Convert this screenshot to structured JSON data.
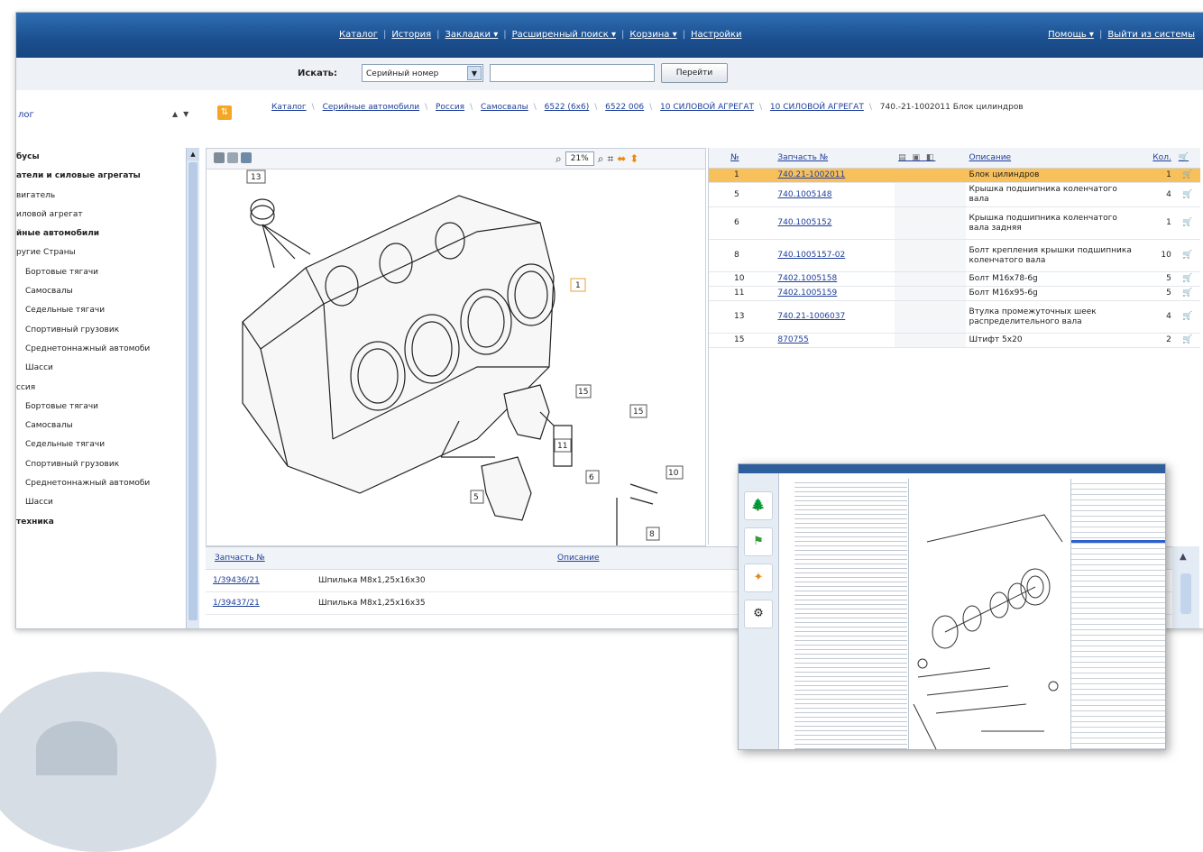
{
  "nav": {
    "items": [
      "Каталог",
      "История",
      "Закладки ▾",
      "Расширенный поиск ▾",
      "Корзина ▾",
      "Настройки"
    ],
    "right": [
      "Помощь ▾",
      "Выйти из системы"
    ]
  },
  "search": {
    "label": "Искать:",
    "type_value": "Серийный номер",
    "input_value": "",
    "go_label": "Перейти"
  },
  "left_header": {
    "catalog_label": "лог"
  },
  "breadcrumb": [
    "Каталог",
    "Серийные автомобили",
    "Россия",
    "Самосвалы",
    "6522 (6x6)",
    "6522 006",
    "10 СИЛОВОЙ АГРЕГАТ",
    "10 СИЛОВОЙ АГРЕГАТ",
    "740.-21-1002011 Блок цилиндров"
  ],
  "tree": [
    {
      "label": "бусы",
      "bold": true,
      "level": 0
    },
    {
      "label": "атели и силовые агрегаты",
      "bold": true,
      "level": 0
    },
    {
      "label": "вигатель",
      "bold": false,
      "level": 0
    },
    {
      "label": "иловой агрегат",
      "bold": false,
      "level": 0
    },
    {
      "label": "йные автомобили",
      "bold": true,
      "level": 0
    },
    {
      "label": "ругие Страны",
      "bold": false,
      "level": 0
    },
    {
      "label": "Бортовые тягачи",
      "bold": false,
      "level": 1
    },
    {
      "label": "Самосвалы",
      "bold": false,
      "level": 1
    },
    {
      "label": "Седельные тягачи",
      "bold": false,
      "level": 1
    },
    {
      "label": "Спортивный грузовик",
      "bold": false,
      "level": 1
    },
    {
      "label": "Среднетоннажный автомоби",
      "bold": false,
      "level": 1
    },
    {
      "label": "Шасси",
      "bold": false,
      "level": 1
    },
    {
      "label": "ссия",
      "bold": false,
      "level": 0
    },
    {
      "label": "Бортовые тягачи",
      "bold": false,
      "level": 1
    },
    {
      "label": "Самосвалы",
      "bold": false,
      "level": 1
    },
    {
      "label": "Седельные тягачи",
      "bold": false,
      "level": 1
    },
    {
      "label": "Спортивный грузовик",
      "bold": false,
      "level": 1
    },
    {
      "label": "Среднетоннажный автомоби",
      "bold": false,
      "level": 1
    },
    {
      "label": "Шасси",
      "bold": false,
      "level": 1
    },
    {
      "label": "техника",
      "bold": true,
      "level": 0
    }
  ],
  "image_toolbar": {
    "zoom": "21%"
  },
  "diagram_labels": [
    "13",
    "1",
    "15",
    "15",
    "11",
    "6",
    "10",
    "5",
    "8"
  ],
  "parts_table": {
    "headers": {
      "num": "№",
      "part": "Запчасть №",
      "desc": "Описание",
      "qty": "Кол."
    },
    "rows": [
      {
        "num": "1",
        "part": "740.21-1002011",
        "desc": "Блок цилиндров",
        "qty": "1",
        "selected": true
      },
      {
        "num": "5",
        "part": "740.1005148",
        "desc": "Крышка подшипника коленчатого вала",
        "qty": "4",
        "selected": false
      },
      {
        "num": "6",
        "part": "740.1005152",
        "desc": "Крышка подшипника коленчатого вала задняя",
        "qty": "1",
        "selected": false
      },
      {
        "num": "8",
        "part": "740.1005157-02",
        "desc": "Болт крепления крышки подшипника коленчатого вала",
        "qty": "10",
        "selected": false
      },
      {
        "num": "10",
        "part": "7402.1005158",
        "desc": "Болт М16х78-6g",
        "qty": "5",
        "selected": false
      },
      {
        "num": "11",
        "part": "7402.1005159",
        "desc": "Болт М16х95-6g",
        "qty": "5",
        "selected": false
      },
      {
        "num": "13",
        "part": "740.21-1006037",
        "desc": "Втулка промежуточных шеек распределительного вала",
        "qty": "4",
        "selected": false
      },
      {
        "num": "15",
        "part": "870755",
        "desc": "Штифт 5х20",
        "qty": "2",
        "selected": false
      }
    ]
  },
  "bottom_list": {
    "headers": {
      "part": "Запчасть №",
      "desc": "Описание"
    },
    "rows": [
      {
        "part": "1/39436/21",
        "desc": "Шпилька М8х1,25х16х30"
      },
      {
        "part": "1/39437/21",
        "desc": "Шпилька М8х1,25х16х35"
      }
    ]
  },
  "colors": {
    "nav_bg": "#1b4f8f",
    "selected_row": "#f8c05a",
    "link": "#1f3f9a"
  }
}
